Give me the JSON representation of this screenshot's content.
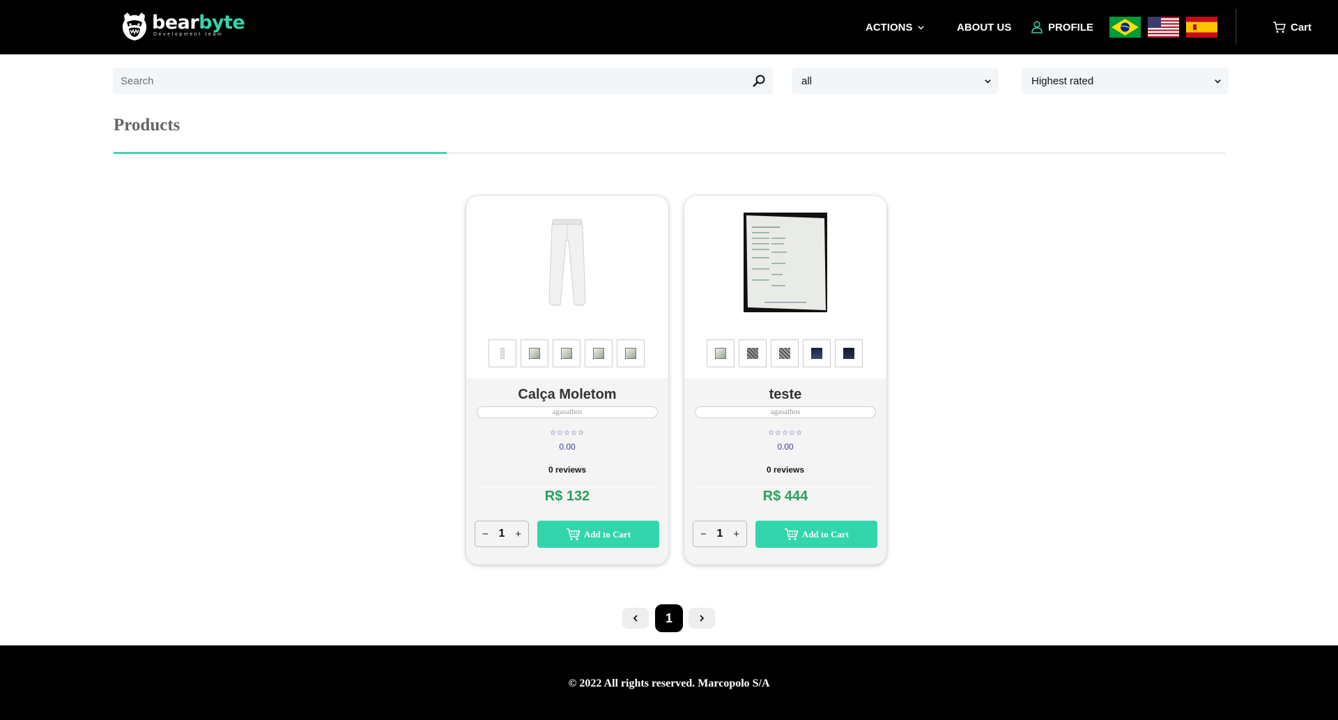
{
  "header": {
    "logo": {
      "word_primary": "bear",
      "word_accent": "byte",
      "tagline": "Development team"
    },
    "nav": {
      "actions": "ACTIONS",
      "about": "ABOUT US",
      "profile": "PROFILE",
      "cart": "Cart"
    },
    "flags": [
      "flag-brazil",
      "flag-usa",
      "flag-spain"
    ]
  },
  "filters": {
    "search_placeholder": "Search",
    "category_value": "all",
    "sort_value": "Highest rated"
  },
  "section": {
    "title": "Products"
  },
  "products": [
    {
      "name": "Calça Moletom",
      "category": "agasalhos",
      "stars": "☆☆☆☆☆",
      "rating": "0.00",
      "reviews": "0 reviews",
      "price": "R$ 132",
      "quantity": "1",
      "add_label": "Add to Cart",
      "thumb_count": 5
    },
    {
      "name": "teste",
      "category": "agasalhos",
      "stars": "☆☆☆☆☆",
      "rating": "0.00",
      "reviews": "0 reviews",
      "price": "R$ 444",
      "quantity": "1",
      "add_label": "Add to Cart",
      "thumb_count": 5
    }
  ],
  "pagination": {
    "current": "1"
  },
  "footer": {
    "text": "© 2022 All rights reserved. Marcopolo S/A"
  },
  "colors": {
    "accent": "#33d6ac",
    "price": "#2aa05e",
    "header_bg": "#000000"
  }
}
